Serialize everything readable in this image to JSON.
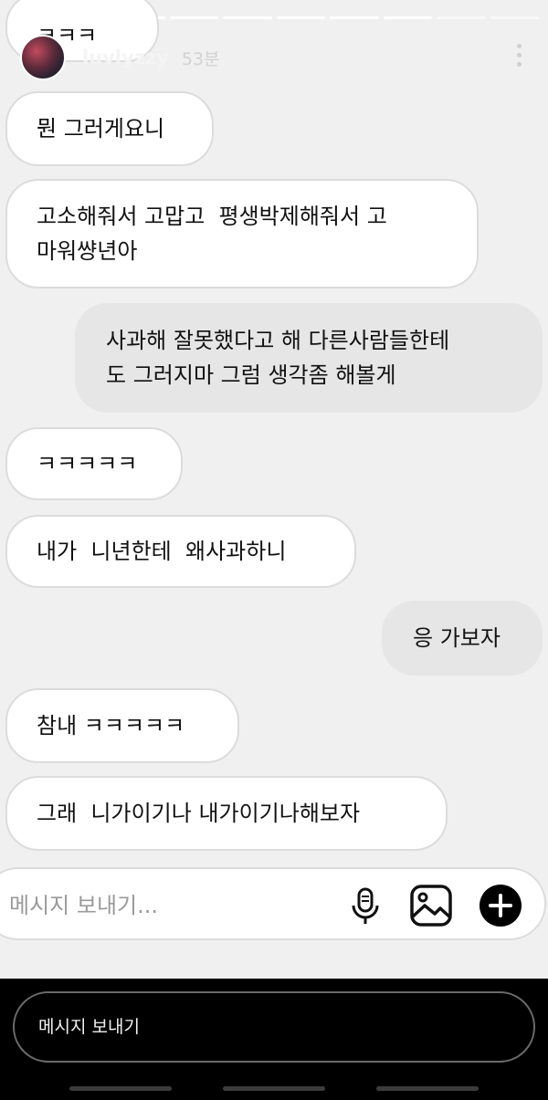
{
  "header": {
    "username": "luvlyzzy",
    "time": "53분"
  },
  "messages": [
    {
      "text": "ㅋㅋㅋ",
      "side": "in"
    },
    {
      "text": "뭔 그러게요니",
      "side": "in"
    },
    {
      "text": "고소해줘서 고맙고  평생박제해줘서 고\n마워썅년아",
      "side": "in"
    },
    {
      "text": "사과해 잘못했다고 해 다른사람들한테\n도 그러지마 그럼 생각좀 해볼게",
      "side": "out"
    },
    {
      "text": "ㅋㅋㅋㅋㅋ",
      "side": "in"
    },
    {
      "text": "내가  니년한테  왜사과하니",
      "side": "in"
    },
    {
      "text": "응 가보자",
      "side": "out"
    },
    {
      "text": "참내 ㅋㅋㅋㅋㅋ",
      "side": "in"
    },
    {
      "text": "그래  니가이기나 내가이기나해보자",
      "side": "in"
    }
  ],
  "composer": {
    "placeholder": "메시지 보내기..."
  },
  "reply": {
    "placeholder": "메시지 보내기"
  },
  "icons": [
    "more-options-icon",
    "microphone-icon",
    "gallery-icon",
    "add-circle-icon"
  ],
  "colors": {
    "story_background": "#f0f0f0",
    "incoming_bubble": "#ffffff",
    "outgoing_bubble": "#e6e6e6",
    "screen_background": "#000000"
  }
}
